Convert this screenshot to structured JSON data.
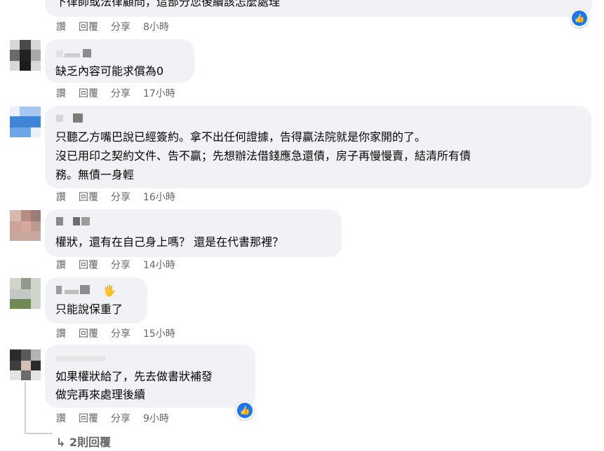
{
  "comments": [
    {
      "lines": [
        "下律師或法律顧問，這部分您後續該怎麼處理"
      ],
      "actions": {
        "read": "讚",
        "reply": "回覆",
        "share": "分享"
      },
      "time": "8小時"
    },
    {
      "lines": [
        "缺乏內容可能求償為0"
      ],
      "actions": {
        "read": "讚",
        "reply": "回覆",
        "share": "分享"
      },
      "time": "17小時"
    },
    {
      "lines": [
        "只聽乙方嘴巴說已經簽約。拿不出任何證據，告得贏法院就是你家開的了。",
        "沒已用印之契約文件、告不贏；先想辦法借錢應急還債，房子再慢慢賣，結清所有債",
        "務。無債一身輕"
      ],
      "actions": {
        "read": "讚",
        "reply": "回覆",
        "share": "分享"
      },
      "time": "16小時"
    },
    {
      "lines": [
        "權狀，還有在自己身上嗎？ 還是在代書那裡？"
      ],
      "actions": {
        "read": "讚",
        "reply": "回覆",
        "share": "分享"
      },
      "time": "14小時"
    },
    {
      "lines": [
        "只能說保重了"
      ],
      "actions": {
        "read": "讚",
        "reply": "回覆",
        "share": "分享"
      },
      "time": "15小時"
    },
    {
      "lines": [
        "如果權狀給了，先去做書狀補發",
        "做完再來處理後續"
      ],
      "actions": {
        "read": "讚",
        "reply": "回覆",
        "share": "分享"
      },
      "time": "9小時"
    }
  ],
  "more_replies": "2則回覆",
  "icons": {
    "like": "like-icon",
    "wave": "wave-icon",
    "reply_arrow": "reply-arrow-icon"
  },
  "colors": {
    "bubble": "#f0f2f5",
    "meta": "#65676b",
    "like": "#1877f2"
  }
}
